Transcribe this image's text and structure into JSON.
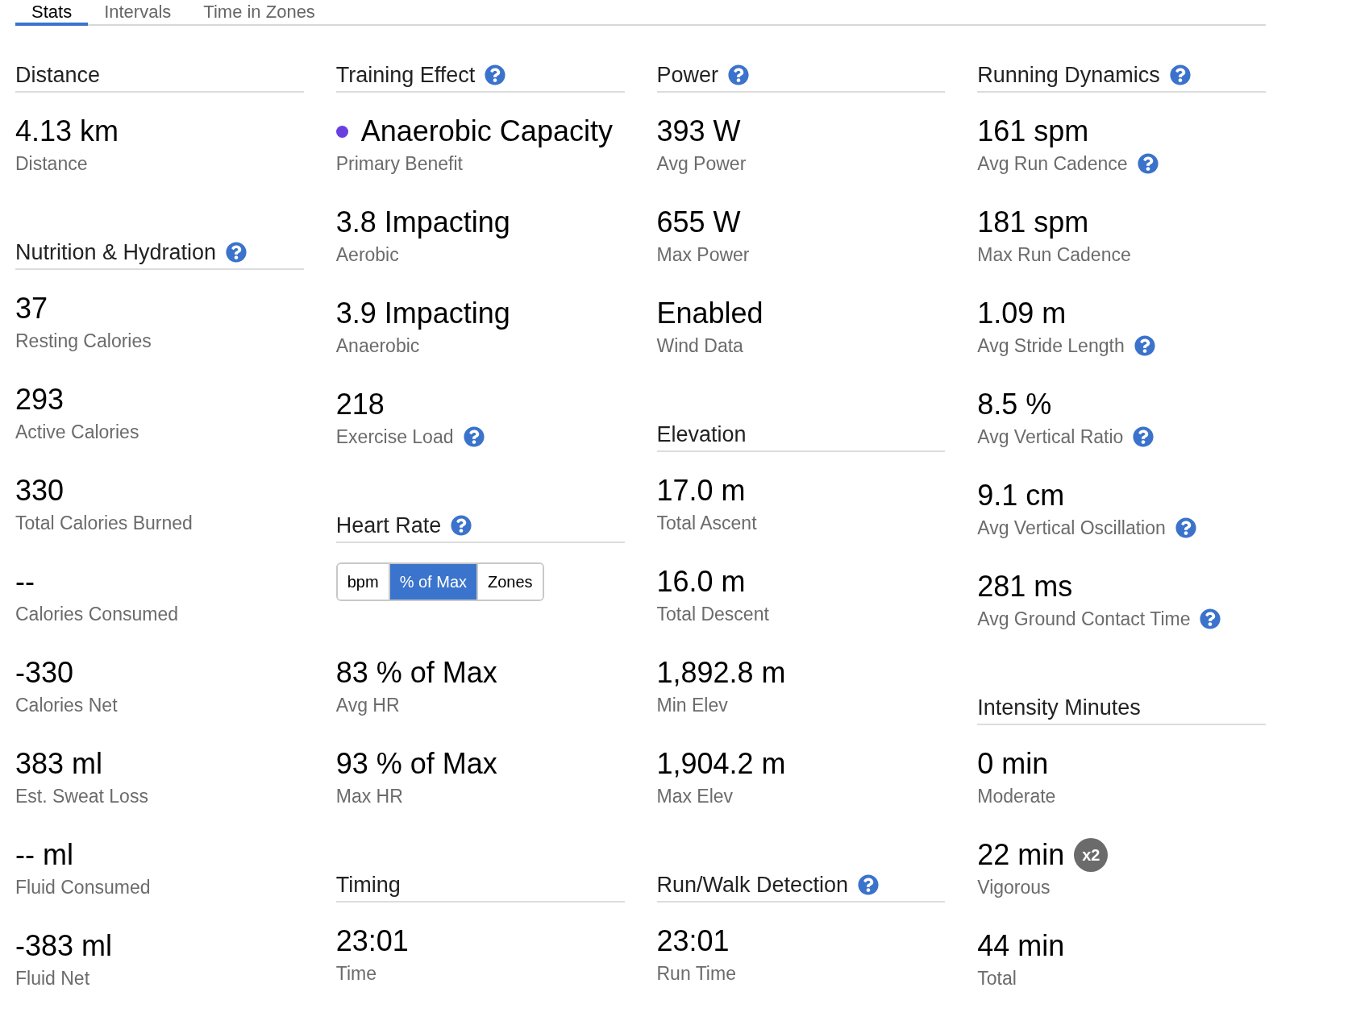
{
  "tabs": [
    {
      "label": "Stats",
      "selected": true
    },
    {
      "label": "Intervals",
      "selected": false
    },
    {
      "label": "Time in Zones",
      "selected": false
    }
  ],
  "columns": [
    {
      "sections": [
        {
          "title": "Distance",
          "help": false,
          "items": [
            {
              "kind": "stat",
              "value": "4.13 km",
              "label": "Distance",
              "help": false
            }
          ]
        },
        {
          "title": "Nutrition & Hydration",
          "help": true,
          "items": [
            {
              "kind": "stat",
              "value": "37",
              "label": "Resting Calories",
              "help": false
            },
            {
              "kind": "stat",
              "value": "293",
              "label": "Active Calories",
              "help": false
            },
            {
              "kind": "stat",
              "value": "330",
              "label": "Total Calories Burned",
              "help": false
            },
            {
              "kind": "stat",
              "value": "--",
              "label": "Calories Consumed",
              "help": false
            },
            {
              "kind": "stat",
              "value": "-330",
              "label": "Calories Net",
              "help": false
            },
            {
              "kind": "stat",
              "value": "383 ml",
              "label": "Est. Sweat Loss",
              "help": false
            },
            {
              "kind": "stat",
              "value": "-- ml",
              "label": "Fluid Consumed",
              "help": false
            },
            {
              "kind": "stat",
              "value": "-383 ml",
              "label": "Fluid Net",
              "help": false
            }
          ]
        }
      ]
    },
    {
      "sections": [
        {
          "title": "Training Effect",
          "help": true,
          "items": [
            {
              "kind": "stat",
              "value": "Anaerobic Capacity",
              "label": "Primary Benefit",
              "help": false,
              "color": "#6a3fe0"
            },
            {
              "kind": "stat",
              "value": "3.8 Impacting",
              "label": "Aerobic",
              "help": false
            },
            {
              "kind": "stat",
              "value": "3.9 Impacting",
              "label": "Anaerobic",
              "help": false
            },
            {
              "kind": "stat",
              "value": "218",
              "label": "Exercise Load",
              "help": true
            }
          ]
        },
        {
          "title": "Heart Rate",
          "help": true,
          "items": [
            {
              "kind": "toggle",
              "options": [
                {
                  "label": "bpm",
                  "selected": false
                },
                {
                  "label": "% of Max",
                  "selected": true
                },
                {
                  "label": "Zones",
                  "selected": false
                }
              ]
            },
            {
              "kind": "stat",
              "value": "83 % of Max",
              "label": "Avg HR",
              "help": false
            },
            {
              "kind": "stat",
              "value": "93 % of Max",
              "label": "Max HR",
              "help": false
            }
          ]
        },
        {
          "title": "Timing",
          "help": false,
          "items": [
            {
              "kind": "stat",
              "value": "23:01",
              "label": "Time",
              "help": false
            }
          ]
        }
      ]
    },
    {
      "sections": [
        {
          "title": "Power",
          "help": true,
          "items": [
            {
              "kind": "stat",
              "value": "393 W",
              "label": "Avg Power",
              "help": false
            },
            {
              "kind": "stat",
              "value": "655 W",
              "label": "Max Power",
              "help": false
            },
            {
              "kind": "stat",
              "value": "Enabled",
              "label": "Wind Data",
              "help": false
            }
          ]
        },
        {
          "title": "Elevation",
          "help": false,
          "items": [
            {
              "kind": "stat",
              "value": "17.0 m",
              "label": "Total Ascent",
              "help": false
            },
            {
              "kind": "stat",
              "value": "16.0 m",
              "label": "Total Descent",
              "help": false
            },
            {
              "kind": "stat",
              "value": "1,892.8 m",
              "label": "Min Elev",
              "help": false
            },
            {
              "kind": "stat",
              "value": "1,904.2 m",
              "label": "Max Elev",
              "help": false
            }
          ]
        },
        {
          "title": "Run/Walk Detection",
          "help": true,
          "items": [
            {
              "kind": "stat",
              "value": "23:01",
              "label": "Run Time",
              "help": false
            }
          ]
        }
      ]
    },
    {
      "sections": [
        {
          "title": "Running Dynamics",
          "help": true,
          "items": [
            {
              "kind": "stat",
              "value": "161 spm",
              "label": "Avg Run Cadence",
              "help": true
            },
            {
              "kind": "stat",
              "value": "181 spm",
              "label": "Max Run Cadence",
              "help": false
            },
            {
              "kind": "stat",
              "value": "1.09 m",
              "label": "Avg Stride Length",
              "help": true
            },
            {
              "kind": "stat",
              "value": "8.5 %",
              "label": "Avg Vertical Ratio",
              "help": true
            },
            {
              "kind": "stat",
              "value": "9.1 cm",
              "label": "Avg Vertical Oscillation",
              "help": true
            },
            {
              "kind": "stat",
              "value": "281 ms",
              "label": "Avg Ground Contact Time",
              "help": true
            }
          ]
        },
        {
          "title": "Intensity Minutes",
          "help": false,
          "items": [
            {
              "kind": "stat",
              "value": "0 min",
              "label": "Moderate",
              "help": false
            },
            {
              "kind": "stat",
              "value": "22 min",
              "label": "Vigorous",
              "help": false,
              "badge": "x2"
            },
            {
              "kind": "stat",
              "value": "44 min",
              "label": "Total",
              "help": false
            }
          ]
        }
      ]
    }
  ]
}
